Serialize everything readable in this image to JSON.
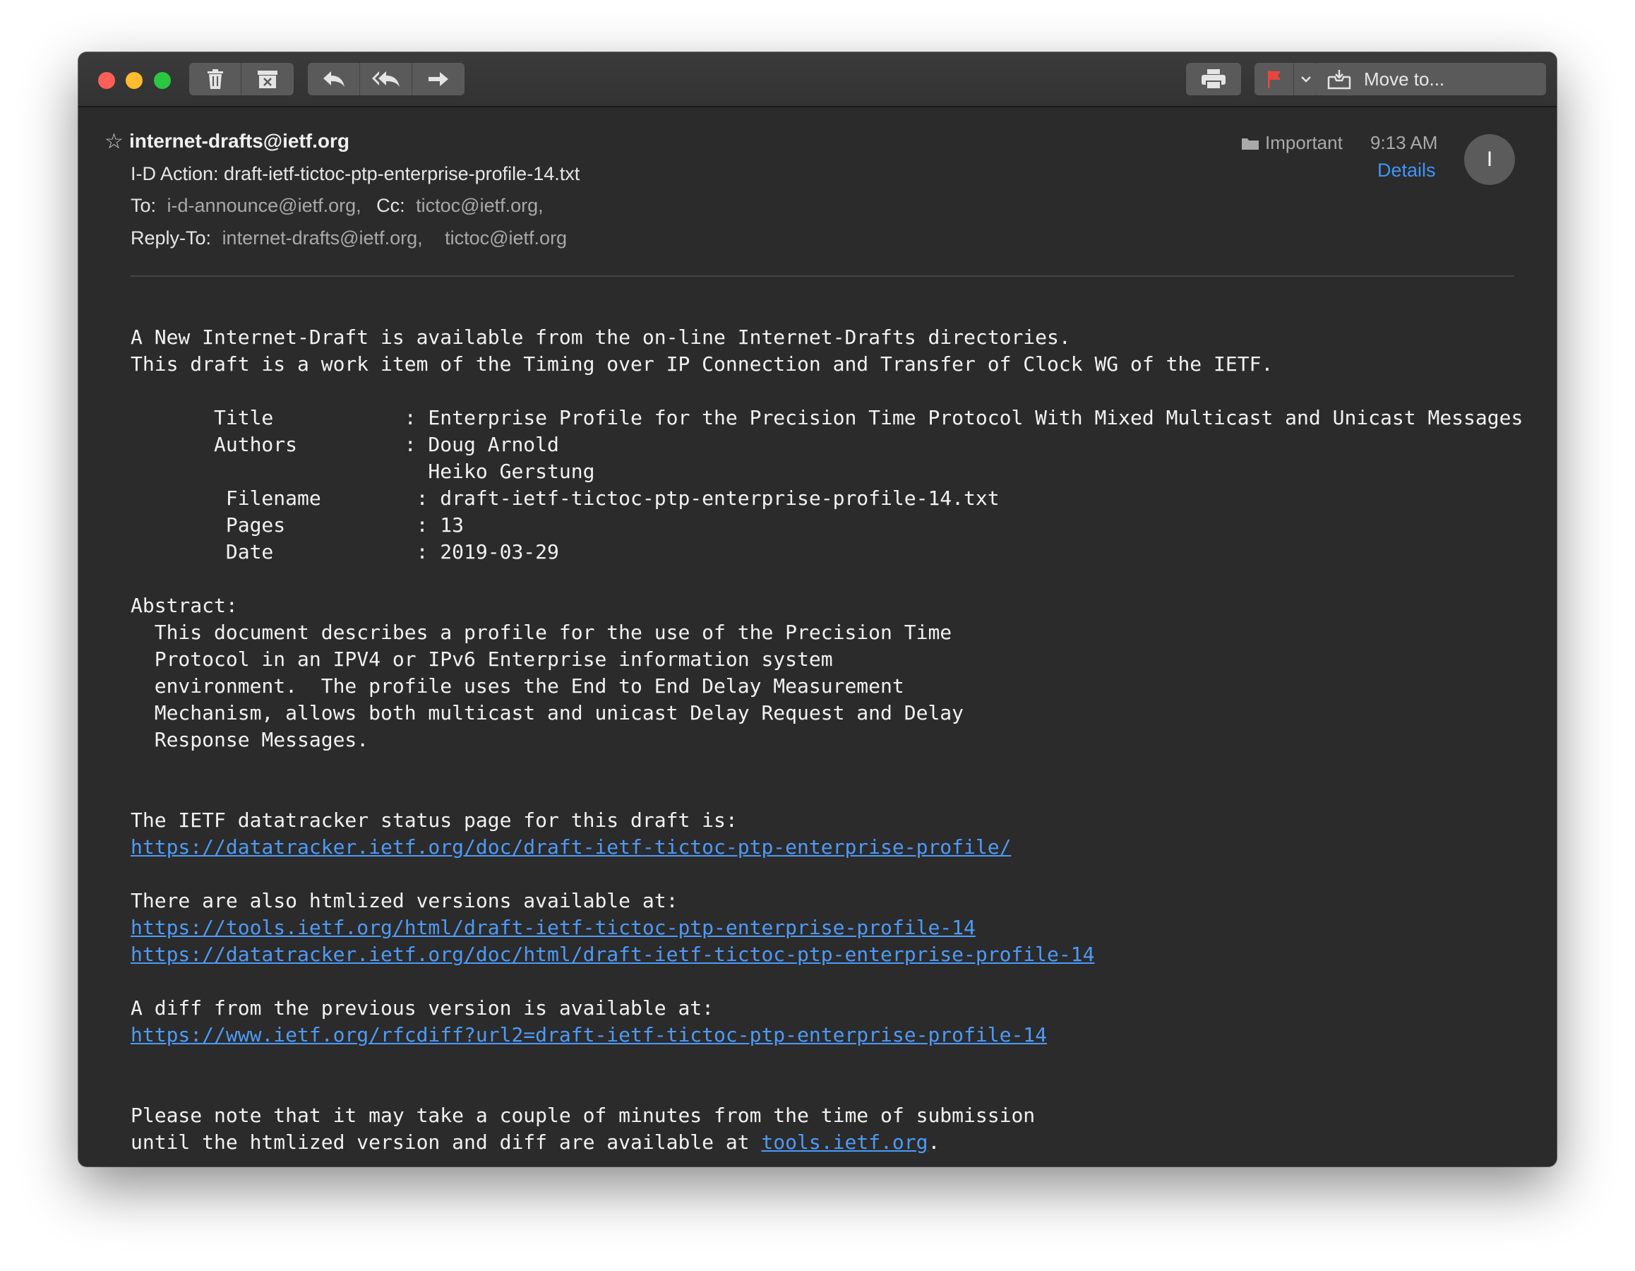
{
  "toolbar": {
    "move_to_label": "Move to..."
  },
  "message": {
    "sender": "internet-drafts@ietf.org",
    "subject": "I-D Action: draft-ietf-tictoc-ptp-enterprise-profile-14.txt",
    "to_label": "To:",
    "to_value": "i-d-announce@ietf.org,",
    "cc_label": "Cc:",
    "cc_value": "tictoc@ietf.org,",
    "reply_to_label": "Reply-To:",
    "reply_to_value_1": "internet-drafts@ietf.org,",
    "reply_to_value_2": "tictoc@ietf.org",
    "folder": "Important",
    "time": "9:13 AM",
    "details_link": "Details",
    "avatar_initial": "I"
  },
  "body": {
    "intro_1": "A New Internet-Draft is available from the on-line Internet-Drafts directories.",
    "intro_2": "This draft is a work item of the Timing over IP Connection and Transfer of Clock WG of the IETF.",
    "title_row": "       Title           : Enterprise Profile for the Precision Time Protocol With Mixed Multicast and Unicast Messages",
    "authors_row": "       Authors         : Doug Arnold",
    "authors_row_2": "                         Heiko Gerstung",
    "filename_row": "\tFilename        : draft-ietf-tictoc-ptp-enterprise-profile-14.txt",
    "pages_row": "\tPages           : 13",
    "date_row": "\tDate            : 2019-03-29",
    "abstract_label": "Abstract:",
    "abstract_1": "  This document describes a profile for the use of the Precision Time",
    "abstract_2": "  Protocol in an IPV4 or IPv6 Enterprise information system",
    "abstract_3": "  environment.  The profile uses the End to End Delay Measurement",
    "abstract_4": "  Mechanism, allows both multicast and unicast Delay Request and Delay",
    "abstract_5": "  Response Messages.",
    "status_intro": "The IETF datatracker status page for this draft is:",
    "status_link": "https://datatracker.ietf.org/doc/draft-ietf-tictoc-ptp-enterprise-profile/",
    "html_intro": "There are also htmlized versions available at:",
    "html_link_1": "https://tools.ietf.org/html/draft-ietf-tictoc-ptp-enterprise-profile-14",
    "html_link_2": "https://datatracker.ietf.org/doc/html/draft-ietf-tictoc-ptp-enterprise-profile-14",
    "diff_intro": "A diff from the previous version is available at:",
    "diff_link": "https://www.ietf.org/rfcdiff?url2=draft-ietf-tictoc-ptp-enterprise-profile-14",
    "note_1": "Please note that it may take a couple of minutes from the time of submission",
    "note_2_prefix": "until the htmlized version and diff are available at ",
    "note_2_link": "tools.ietf.org",
    "note_2_suffix": "."
  },
  "colors": {
    "window_bg": "#2b2b2b",
    "link": "#4e9af7",
    "accent_blue": "#3f95f7",
    "flag_red": "#e8453c"
  }
}
